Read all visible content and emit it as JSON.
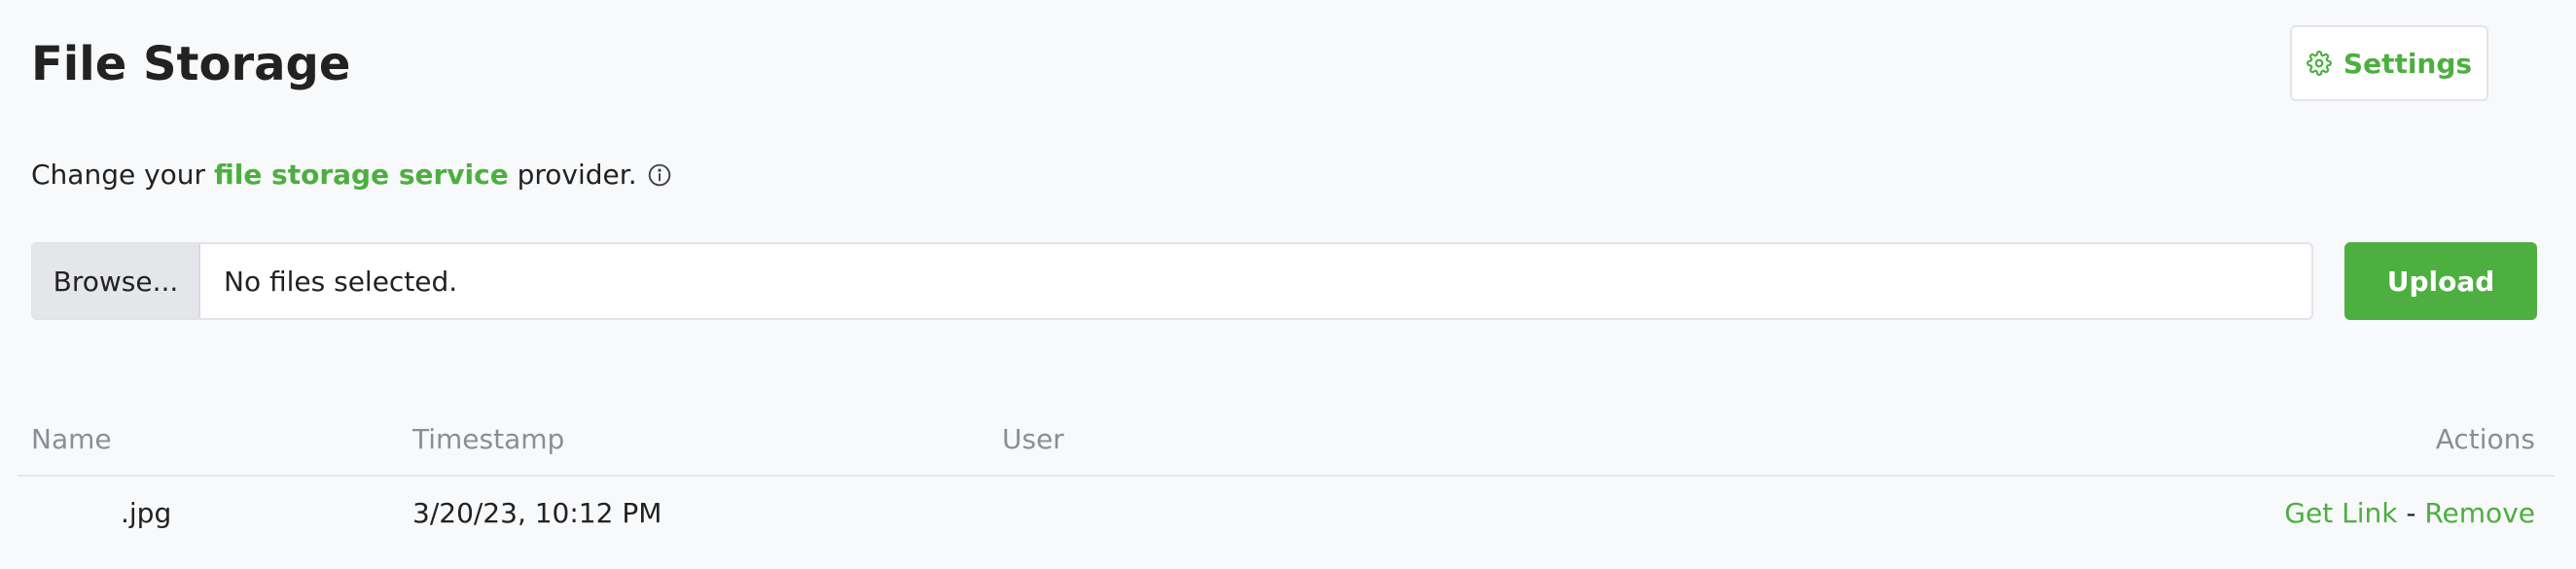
{
  "page": {
    "title": "File Storage"
  },
  "header": {
    "settings_label": "Settings",
    "settings_icon": "gear-icon"
  },
  "subtitle": {
    "prefix": "Change your ",
    "link": "file storage service",
    "suffix": " provider.",
    "info_icon": "info-icon"
  },
  "file_input": {
    "browse_label": "Browse...",
    "status": "No files selected."
  },
  "upload": {
    "label": "Upload"
  },
  "table": {
    "columns": {
      "name": "Name",
      "timestamp": "Timestamp",
      "user": "User",
      "actions": "Actions"
    },
    "rows": [
      {
        "name": ".jpg",
        "timestamp": "3/20/23, 10:12 PM",
        "user": "",
        "get_link": "Get Link",
        "separator": " - ",
        "remove": "Remove"
      }
    ]
  },
  "colors": {
    "accent": "#4caf3f",
    "background": "#f8f9fb",
    "text": "#222222",
    "muted": "#8a8f96"
  }
}
